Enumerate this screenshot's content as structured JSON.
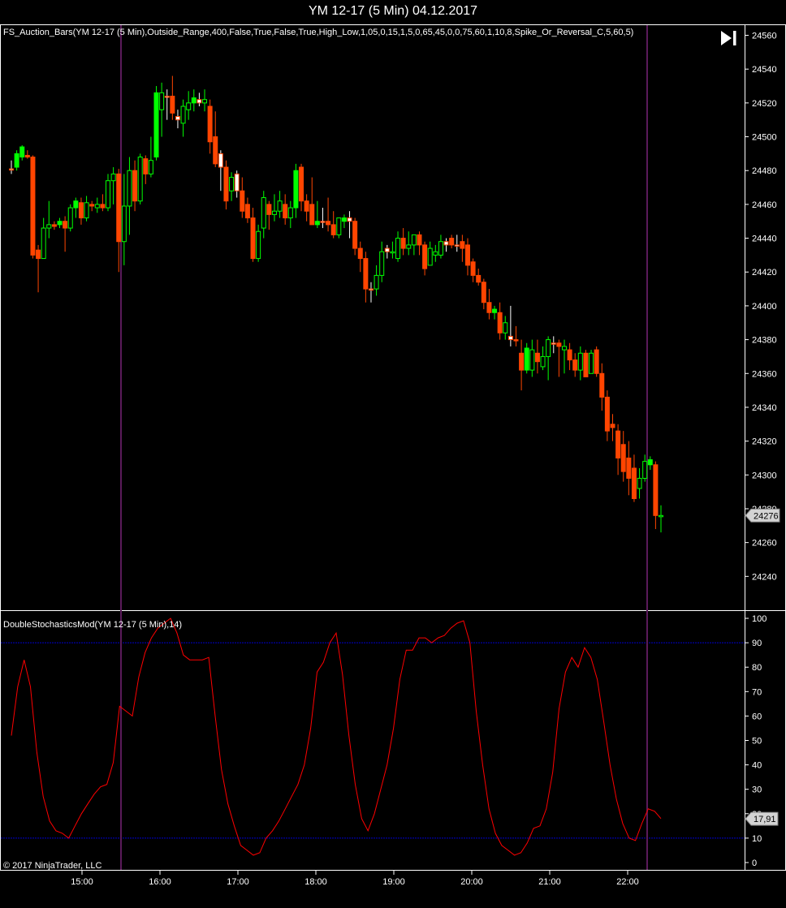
{
  "window": {
    "title": "YM 12-17 (5 Min)  04.12.2017",
    "copyright": "© 2017 NinjaTrader, LLC"
  },
  "icons": {
    "play_end": "skip-to-end-icon"
  },
  "colors": {
    "background": "#000000",
    "bull": "#00ff00",
    "bear": "#ff4500",
    "neutral": "#ffffff",
    "stoch_line": "#ff0000",
    "level_line": "#0000cd",
    "session_line": "#5a1a5a",
    "axis": "#ffffff"
  },
  "chart_data": [
    {
      "type": "candlestick",
      "indicator_label": "FS_Auction_Bars(YM 12-17 (5 Min),Outside_Range,400,False,True,False,True,High_Low,1,05,0,15,1,5,0,65,45,0,0,75,60,1,10,8,Spike_Or_Reversal_C,5,60,5)",
      "ylim": [
        24220,
        24566
      ],
      "y_ticks": [
        24240,
        24260,
        24280,
        24300,
        24320,
        24340,
        24360,
        24380,
        24400,
        24420,
        24440,
        24460,
        24480,
        24500,
        24520,
        24540,
        24560
      ],
      "last_price": "24276",
      "session_marks": [
        "15:30",
        "22:15"
      ],
      "bars": [
        {
          "o": 24481,
          "h": 24486,
          "l": 24478,
          "c": 24481,
          "t": "n"
        },
        {
          "o": 24482,
          "h": 24492,
          "l": 24480,
          "c": 24490,
          "t": "b"
        },
        {
          "o": 24488,
          "h": 24495,
          "l": 24486,
          "c": 24494,
          "t": "b"
        },
        {
          "o": 24489,
          "h": 24492,
          "l": 24487,
          "c": 24488,
          "t": "r"
        },
        {
          "o": 24488,
          "h": 24489,
          "l": 24428,
          "c": 24430,
          "t": "r"
        },
        {
          "o": 24433,
          "h": 24436,
          "l": 24408,
          "c": 24428,
          "t": "r"
        },
        {
          "o": 24428,
          "h": 24452,
          "l": 24428,
          "c": 24446,
          "t": "g"
        },
        {
          "o": 24446,
          "h": 24462,
          "l": 24440,
          "c": 24448,
          "t": "g"
        },
        {
          "o": 24448,
          "h": 24450,
          "l": 24445,
          "c": 24447,
          "t": "r"
        },
        {
          "o": 24448,
          "h": 24452,
          "l": 24446,
          "c": 24450,
          "t": "b"
        },
        {
          "o": 24450,
          "h": 24453,
          "l": 24432,
          "c": 24446,
          "t": "r"
        },
        {
          "o": 24446,
          "h": 24460,
          "l": 24444,
          "c": 24458,
          "t": "g"
        },
        {
          "o": 24458,
          "h": 24464,
          "l": 24452,
          "c": 24462,
          "t": "b"
        },
        {
          "o": 24461,
          "h": 24464,
          "l": 24448,
          "c": 24452,
          "t": "r"
        },
        {
          "o": 24452,
          "h": 24465,
          "l": 24450,
          "c": 24461,
          "t": "g"
        },
        {
          "o": 24460,
          "h": 24462,
          "l": 24456,
          "c": 24459,
          "t": "r"
        },
        {
          "o": 24458,
          "h": 24464,
          "l": 24455,
          "c": 24460,
          "t": "g"
        },
        {
          "o": 24460,
          "h": 24466,
          "l": 24456,
          "c": 24458,
          "t": "r"
        },
        {
          "o": 24458,
          "h": 24478,
          "l": 24456,
          "c": 24474,
          "t": "g"
        },
        {
          "o": 24474,
          "h": 24482,
          "l": 24460,
          "c": 24478,
          "t": "g"
        },
        {
          "o": 24478,
          "h": 24481,
          "l": 24420,
          "c": 24438,
          "t": "r"
        },
        {
          "o": 24438,
          "h": 24478,
          "l": 24424,
          "c": 24459,
          "t": "g"
        },
        {
          "o": 24459,
          "h": 24488,
          "l": 24442,
          "c": 24480,
          "t": "g"
        },
        {
          "o": 24480,
          "h": 24486,
          "l": 24456,
          "c": 24462,
          "t": "r"
        },
        {
          "o": 24462,
          "h": 24490,
          "l": 24460,
          "c": 24488,
          "t": "g"
        },
        {
          "o": 24487,
          "h": 24489,
          "l": 24472,
          "c": 24478,
          "t": "r"
        },
        {
          "o": 24478,
          "h": 24500,
          "l": 24476,
          "c": 24486,
          "t": "g"
        },
        {
          "o": 24488,
          "h": 24530,
          "l": 24486,
          "c": 24526,
          "t": "b"
        },
        {
          "o": 24526,
          "h": 24532,
          "l": 24500,
          "c": 24516,
          "t": "g"
        },
        {
          "o": 24524,
          "h": 24528,
          "l": 24510,
          "c": 24524,
          "t": "n"
        },
        {
          "o": 24524,
          "h": 24536,
          "l": 24510,
          "c": 24514,
          "t": "r"
        },
        {
          "o": 24512,
          "h": 24516,
          "l": 24505,
          "c": 24510,
          "t": "n"
        },
        {
          "o": 24508,
          "h": 24522,
          "l": 24500,
          "c": 24518,
          "t": "g"
        },
        {
          "o": 24516,
          "h": 24527,
          "l": 24510,
          "c": 24520,
          "t": "g"
        },
        {
          "o": 24520,
          "h": 24528,
          "l": 24515,
          "c": 24523,
          "t": "b"
        },
        {
          "o": 24522,
          "h": 24526,
          "l": 24518,
          "c": 24520,
          "t": "n"
        },
        {
          "o": 24520,
          "h": 24528,
          "l": 24515,
          "c": 24522,
          "t": "g"
        },
        {
          "o": 24518,
          "h": 24522,
          "l": 24490,
          "c": 24497,
          "t": "r"
        },
        {
          "o": 24500,
          "h": 24515,
          "l": 24482,
          "c": 24484,
          "t": "r"
        },
        {
          "o": 24490,
          "h": 24492,
          "l": 24468,
          "c": 24482,
          "t": "n"
        },
        {
          "o": 24482,
          "h": 24486,
          "l": 24457,
          "c": 24462,
          "t": "r"
        },
        {
          "o": 24468,
          "h": 24479,
          "l": 24462,
          "c": 24476,
          "t": "g"
        },
        {
          "o": 24478,
          "h": 24480,
          "l": 24464,
          "c": 24468,
          "t": "n"
        },
        {
          "o": 24468,
          "h": 24476,
          "l": 24452,
          "c": 24456,
          "t": "r"
        },
        {
          "o": 24460,
          "h": 24464,
          "l": 24449,
          "c": 24452,
          "t": "r"
        },
        {
          "o": 24452,
          "h": 24458,
          "l": 24426,
          "c": 24428,
          "t": "r"
        },
        {
          "o": 24428,
          "h": 24448,
          "l": 24426,
          "c": 24444,
          "t": "g"
        },
        {
          "o": 24446,
          "h": 24468,
          "l": 24440,
          "c": 24464,
          "t": "g"
        },
        {
          "o": 24460,
          "h": 24462,
          "l": 24445,
          "c": 24454,
          "t": "r"
        },
        {
          "o": 24454,
          "h": 24466,
          "l": 24450,
          "c": 24456,
          "t": "g"
        },
        {
          "o": 24456,
          "h": 24468,
          "l": 24452,
          "c": 24462,
          "t": "g"
        },
        {
          "o": 24460,
          "h": 24466,
          "l": 24448,
          "c": 24452,
          "t": "r"
        },
        {
          "o": 24452,
          "h": 24462,
          "l": 24446,
          "c": 24458,
          "t": "g"
        },
        {
          "o": 24458,
          "h": 24484,
          "l": 24452,
          "c": 24480,
          "t": "b"
        },
        {
          "o": 24482,
          "h": 24484,
          "l": 24456,
          "c": 24462,
          "t": "r"
        },
        {
          "o": 24462,
          "h": 24466,
          "l": 24450,
          "c": 24456,
          "t": "r"
        },
        {
          "o": 24460,
          "h": 24476,
          "l": 24448,
          "c": 24448,
          "t": "r"
        },
        {
          "o": 24450,
          "h": 24462,
          "l": 24446,
          "c": 24448,
          "t": "b"
        },
        {
          "o": 24450,
          "h": 24458,
          "l": 24446,
          "c": 24450,
          "t": "n"
        },
        {
          "o": 24450,
          "h": 24464,
          "l": 24444,
          "c": 24448,
          "t": "r"
        },
        {
          "o": 24448,
          "h": 24456,
          "l": 24440,
          "c": 24442,
          "t": "r"
        },
        {
          "o": 24442,
          "h": 24452,
          "l": 24440,
          "c": 24452,
          "t": "g"
        },
        {
          "o": 24452,
          "h": 24454,
          "l": 24446,
          "c": 24450,
          "t": "b"
        },
        {
          "o": 24452,
          "h": 24456,
          "l": 24440,
          "c": 24450,
          "t": "n"
        },
        {
          "o": 24450,
          "h": 24452,
          "l": 24430,
          "c": 24434,
          "t": "r"
        },
        {
          "o": 24434,
          "h": 24438,
          "l": 24420,
          "c": 24428,
          "t": "r"
        },
        {
          "o": 24428,
          "h": 24432,
          "l": 24402,
          "c": 24410,
          "t": "r"
        },
        {
          "o": 24410,
          "h": 24414,
          "l": 24402,
          "c": 24410,
          "t": "n"
        },
        {
          "o": 24410,
          "h": 24424,
          "l": 24406,
          "c": 24418,
          "t": "g"
        },
        {
          "o": 24418,
          "h": 24438,
          "l": 24414,
          "c": 24432,
          "t": "g"
        },
        {
          "o": 24434,
          "h": 24436,
          "l": 24428,
          "c": 24432,
          "t": "n"
        },
        {
          "o": 24432,
          "h": 24438,
          "l": 24428,
          "c": 24432,
          "t": "g"
        },
        {
          "o": 24428,
          "h": 24444,
          "l": 24426,
          "c": 24440,
          "t": "g"
        },
        {
          "o": 24440,
          "h": 24446,
          "l": 24430,
          "c": 24434,
          "t": "r"
        },
        {
          "o": 24434,
          "h": 24444,
          "l": 24430,
          "c": 24436,
          "t": "g"
        },
        {
          "o": 24436,
          "h": 24442,
          "l": 24430,
          "c": 24442,
          "t": "g"
        },
        {
          "o": 24442,
          "h": 24444,
          "l": 24430,
          "c": 24436,
          "t": "r"
        },
        {
          "o": 24436,
          "h": 24438,
          "l": 24418,
          "c": 24422,
          "t": "r"
        },
        {
          "o": 24424,
          "h": 24438,
          "l": 24424,
          "c": 24434,
          "t": "g"
        },
        {
          "o": 24432,
          "h": 24436,
          "l": 24426,
          "c": 24430,
          "t": "g"
        },
        {
          "o": 24430,
          "h": 24442,
          "l": 24428,
          "c": 24438,
          "t": "g"
        },
        {
          "o": 24438,
          "h": 24440,
          "l": 24432,
          "c": 24436,
          "t": "n"
        },
        {
          "o": 24440,
          "h": 24442,
          "l": 24434,
          "c": 24436,
          "t": "r"
        },
        {
          "o": 24436,
          "h": 24442,
          "l": 24432,
          "c": 24436,
          "t": "n"
        },
        {
          "o": 24438,
          "h": 24442,
          "l": 24426,
          "c": 24434,
          "t": "r"
        },
        {
          "o": 24436,
          "h": 24440,
          "l": 24418,
          "c": 24424,
          "t": "r"
        },
        {
          "o": 24426,
          "h": 24428,
          "l": 24414,
          "c": 24418,
          "t": "r"
        },
        {
          "o": 24418,
          "h": 24422,
          "l": 24412,
          "c": 24414,
          "t": "r"
        },
        {
          "o": 24414,
          "h": 24416,
          "l": 24398,
          "c": 24402,
          "t": "r"
        },
        {
          "o": 24402,
          "h": 24410,
          "l": 24392,
          "c": 24396,
          "t": "r"
        },
        {
          "o": 24398,
          "h": 24400,
          "l": 24392,
          "c": 24396,
          "t": "b"
        },
        {
          "o": 24396,
          "h": 24402,
          "l": 24380,
          "c": 24384,
          "t": "r"
        },
        {
          "o": 24384,
          "h": 24394,
          "l": 24380,
          "c": 24390,
          "t": "g"
        },
        {
          "o": 24382,
          "h": 24400,
          "l": 24376,
          "c": 24380,
          "t": "n"
        },
        {
          "o": 24380,
          "h": 24388,
          "l": 24376,
          "c": 24380,
          "t": "r"
        },
        {
          "o": 24372,
          "h": 24380,
          "l": 24350,
          "c": 24362,
          "t": "r"
        },
        {
          "o": 24362,
          "h": 24378,
          "l": 24360,
          "c": 24375,
          "t": "b"
        },
        {
          "o": 24362,
          "h": 24380,
          "l": 24358,
          "c": 24374,
          "t": "g"
        },
        {
          "o": 24372,
          "h": 24380,
          "l": 24360,
          "c": 24367,
          "t": "r"
        },
        {
          "o": 24364,
          "h": 24376,
          "l": 24362,
          "c": 24370,
          "t": "g"
        },
        {
          "o": 24370,
          "h": 24382,
          "l": 24356,
          "c": 24380,
          "t": "g"
        },
        {
          "o": 24378,
          "h": 24382,
          "l": 24372,
          "c": 24378,
          "t": "n"
        },
        {
          "o": 24378,
          "h": 24380,
          "l": 24358,
          "c": 24376,
          "t": "r"
        },
        {
          "o": 24376,
          "h": 24380,
          "l": 24360,
          "c": 24374,
          "t": "g"
        },
        {
          "o": 24374,
          "h": 24378,
          "l": 24362,
          "c": 24368,
          "t": "r"
        },
        {
          "o": 24368,
          "h": 24372,
          "l": 24358,
          "c": 24362,
          "t": "r"
        },
        {
          "o": 24362,
          "h": 24376,
          "l": 24356,
          "c": 24372,
          "t": "g"
        },
        {
          "o": 24372,
          "h": 24374,
          "l": 24358,
          "c": 24358,
          "t": "r"
        },
        {
          "o": 24360,
          "h": 24374,
          "l": 24360,
          "c": 24372,
          "t": "g"
        },
        {
          "o": 24374,
          "h": 24376,
          "l": 24358,
          "c": 24360,
          "t": "r"
        },
        {
          "o": 24360,
          "h": 24366,
          "l": 24338,
          "c": 24346,
          "t": "r"
        },
        {
          "o": 24346,
          "h": 24350,
          "l": 24320,
          "c": 24326,
          "t": "r"
        },
        {
          "o": 24330,
          "h": 24336,
          "l": 24320,
          "c": 24328,
          "t": "r"
        },
        {
          "o": 24326,
          "h": 24330,
          "l": 24300,
          "c": 24310,
          "t": "r"
        },
        {
          "o": 24318,
          "h": 24326,
          "l": 24296,
          "c": 24302,
          "t": "r"
        },
        {
          "o": 24310,
          "h": 24320,
          "l": 24288,
          "c": 24298,
          "t": "r"
        },
        {
          "o": 24304,
          "h": 24312,
          "l": 24284,
          "c": 24286,
          "t": "r"
        },
        {
          "o": 24292,
          "h": 24304,
          "l": 24286,
          "c": 24298,
          "t": "g"
        },
        {
          "o": 24298,
          "h": 24312,
          "l": 24296,
          "c": 24308,
          "t": "g"
        },
        {
          "o": 24309,
          "h": 24311,
          "l": 24303,
          "c": 24306,
          "t": "b"
        },
        {
          "o": 24306,
          "h": 24308,
          "l": 24268,
          "c": 24276,
          "t": "r"
        },
        {
          "o": 24276,
          "h": 24282,
          "l": 24266,
          "c": 24276,
          "t": "g"
        }
      ]
    },
    {
      "type": "line",
      "indicator_label": "DoubleStochasticsMod(YM 12-17 (5 Min),14)",
      "ylim": [
        -3,
        103
      ],
      "y_ticks": [
        0,
        10,
        20,
        30,
        40,
        50,
        60,
        70,
        80,
        90,
        100
      ],
      "x_ticks": [
        "15:00",
        "16:00",
        "17:00",
        "18:00",
        "19:00",
        "20:00",
        "21:00",
        "22:00"
      ],
      "level_lines": [
        90,
        10
      ],
      "last_value": "17,91",
      "series": [
        {
          "values": [
            52,
            72,
            83,
            72,
            45,
            27,
            17,
            13,
            12,
            10,
            15,
            20,
            24,
            28,
            31,
            32,
            41,
            64,
            62,
            60,
            76,
            86,
            92,
            96,
            98,
            100,
            94,
            85,
            83,
            83,
            83,
            84,
            60,
            38,
            24,
            15,
            7,
            5,
            3,
            4,
            10,
            13,
            17,
            22,
            27,
            32,
            40,
            55,
            78,
            82,
            90,
            94,
            77,
            52,
            32,
            18,
            13,
            20,
            30,
            40,
            55,
            75,
            87,
            87,
            92,
            92,
            90,
            92,
            93,
            96,
            98,
            99,
            90,
            62,
            40,
            22,
            12,
            7,
            5,
            3,
            4,
            8,
            14,
            15,
            22,
            37,
            63,
            78,
            84,
            80,
            88,
            84,
            75,
            58,
            40,
            26,
            16,
            10,
            9,
            16,
            22,
            21,
            18
          ]
        }
      ]
    }
  ]
}
